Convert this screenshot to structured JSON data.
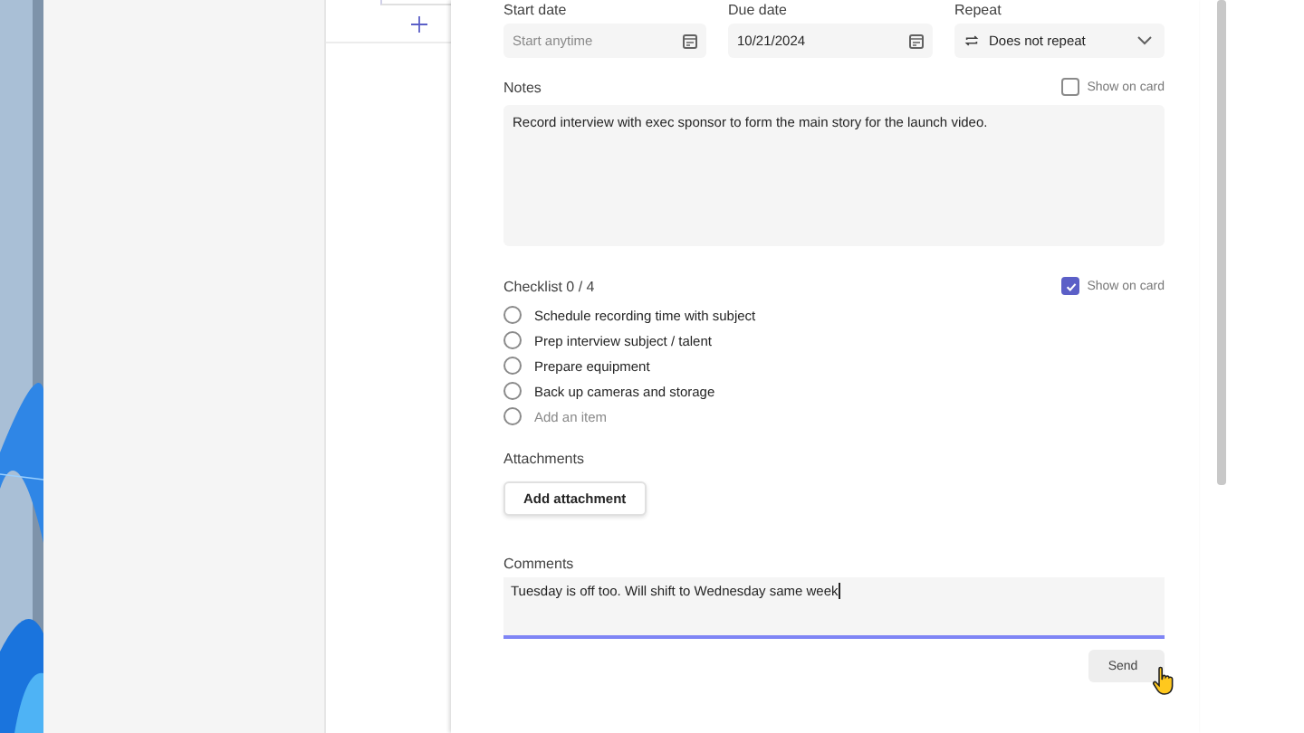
{
  "fields": [
    {
      "kind": "date",
      "label": "Start date",
      "placeholder": "Start anytime"
    },
    {
      "kind": "date",
      "label": "Due date",
      "value": "10/21/2024"
    },
    {
      "kind": "select",
      "label": "Repeat",
      "value": "Does not repeat"
    }
  ],
  "notes": {
    "label": "Notes",
    "show_on_card": {
      "label": "Show on card",
      "checked": false
    },
    "value": "Record interview with exec sponsor to form the main story for the launch video."
  },
  "checklist": {
    "label": "Checklist 0 / 4",
    "show_on_card": {
      "label": "Show on card",
      "checked": true
    },
    "items": [
      {
        "text": "Schedule recording time with subject",
        "checked": false
      },
      {
        "text": "Prep interview subject / talent",
        "checked": false
      },
      {
        "text": "Prepare equipment",
        "checked": false
      },
      {
        "text": "Back up cameras and storage",
        "checked": false
      }
    ],
    "add_item": {
      "placeholder": "Add an item"
    }
  },
  "attachments": {
    "label": "Attachments",
    "button": "Add attachment"
  },
  "comments": {
    "label": "Comments",
    "value": "Tuesday is off too. Will shift to Wednesday same week",
    "button": "Send"
  }
}
